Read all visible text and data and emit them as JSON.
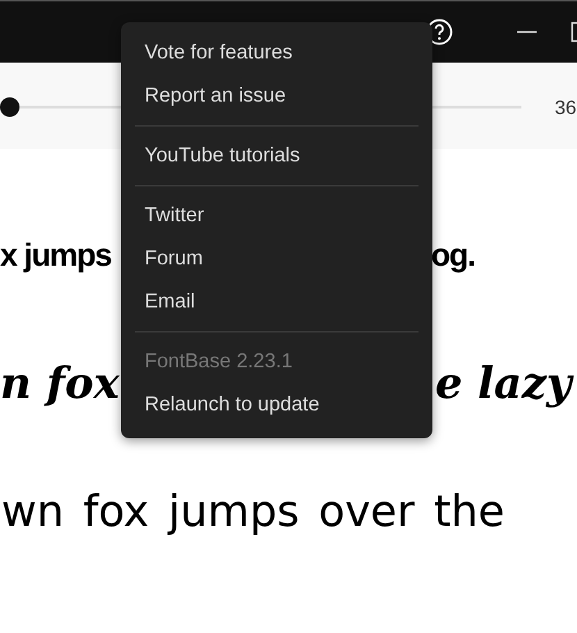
{
  "title_bar": {
    "buttons": [
      {
        "kind": "help"
      },
      {
        "kind": "minimize"
      },
      {
        "kind": "maximize"
      }
    ]
  },
  "toolbar": {
    "size_slider": {
      "level": 0
    },
    "size_reading": "36"
  },
  "preview_lines": [
    {
      "kind": "bold",
      "segments": [
        "x jumps",
        "og."
      ]
    },
    {
      "kind": "script",
      "segments": [
        "n fox",
        "e lazy"
      ]
    },
    {
      "kind": "geometric",
      "segments": [
        "wn fox jumps over the"
      ]
    }
  ],
  "menu": {
    "groups": [
      [
        {
          "label": "Vote for features",
          "disabled": false
        },
        {
          "label": "Report an issue",
          "disabled": false
        }
      ],
      [
        {
          "label": "YouTube tutorials",
          "disabled": false
        }
      ],
      [
        {
          "label": "Twitter",
          "disabled": false
        },
        {
          "label": "Forum",
          "disabled": false
        },
        {
          "label": "Email",
          "disabled": false
        }
      ],
      [
        {
          "label": "FontBase 2.23.1",
          "disabled": true
        },
        {
          "label": "Relaunch to update",
          "disabled": false
        }
      ]
    ]
  }
}
